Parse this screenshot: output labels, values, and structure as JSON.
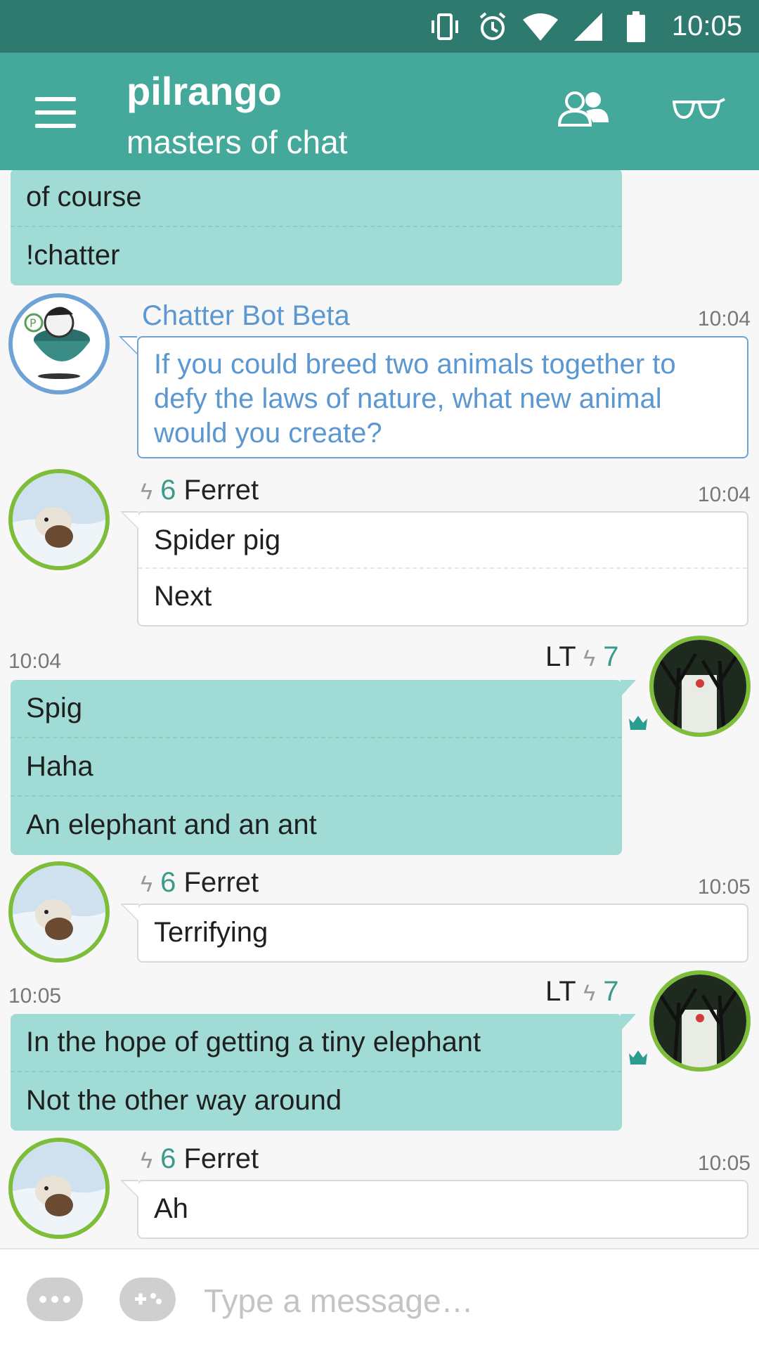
{
  "status_bar": {
    "time": "10:05"
  },
  "app_bar": {
    "title": "pilrango",
    "subtitle": "masters of chat"
  },
  "messages": {
    "m0": {
      "lines": [
        "of course",
        "!chatter"
      ]
    },
    "m1": {
      "sender": "Chatter Bot Beta",
      "time": "10:04",
      "text": "If you could breed two animals together to defy the laws of nature, what new animal would you create?"
    },
    "m2": {
      "level": "6",
      "sender": "Ferret",
      "time": "10:04",
      "lines": [
        "Spider pig",
        "Next"
      ]
    },
    "m3": {
      "sender": "LT",
      "level": "7",
      "time": "10:04",
      "lines": [
        "Spig",
        "Haha",
        "An elephant and an ant"
      ]
    },
    "m4": {
      "level": "6",
      "sender": "Ferret",
      "time": "10:05",
      "lines": [
        "Terrifying"
      ]
    },
    "m5": {
      "sender": "LT",
      "level": "7",
      "time": "10:05",
      "lines": [
        "In the hope of getting a tiny elephant",
        "Not the other way around"
      ]
    },
    "m6": {
      "level": "6",
      "sender": "Ferret",
      "time": "10:05",
      "lines": [
        "Ah"
      ]
    }
  },
  "input": {
    "placeholder": "Type a message…"
  },
  "colors": {
    "status_bar": "#2f7a6e",
    "app_bar": "#44a89b",
    "own_bubble": "#a1dbd5",
    "level": "#3a9b8c",
    "bot": "#5b97d0",
    "avatar_ring": "#7ebd3a"
  },
  "icons": [
    "vibrate-icon",
    "alarm-icon",
    "wifi-icon",
    "signal-icon",
    "battery-icon",
    "menu-icon",
    "users-icon",
    "glasses-icon",
    "bolt-icon",
    "crown-icon",
    "more-icon",
    "gamepad-icon"
  ]
}
